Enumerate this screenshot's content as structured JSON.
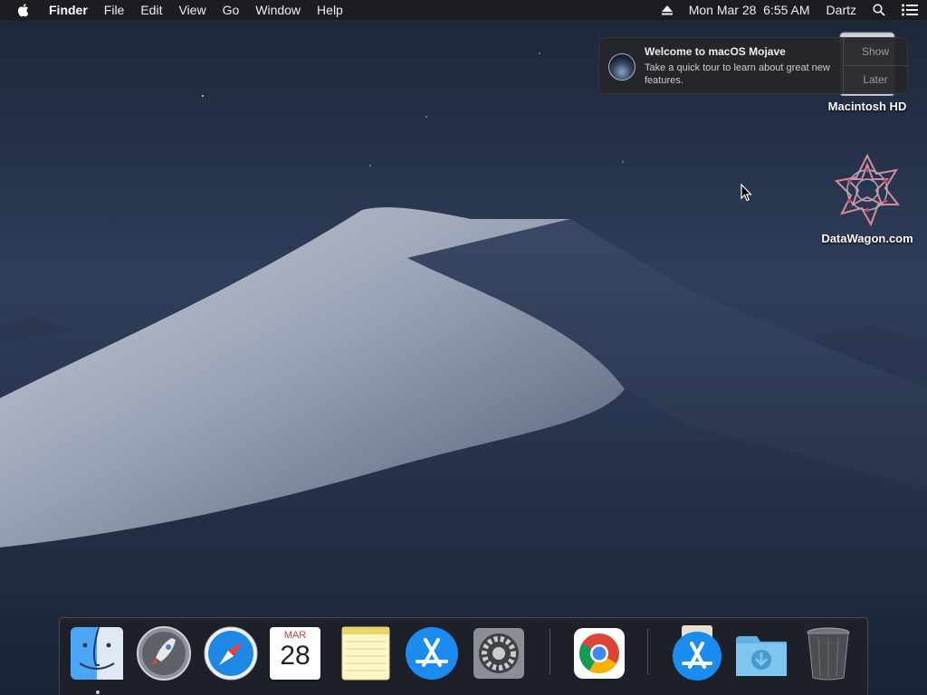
{
  "menubar": {
    "app_name": "Finder",
    "items": [
      "File",
      "Edit",
      "View",
      "Go",
      "Window",
      "Help"
    ],
    "clock": "Mon Mar 28  6:55 AM",
    "user": "Dartz",
    "icons": [
      "apple-icon",
      "eject-icon",
      "spotlight-search-icon",
      "notification-center-icon"
    ]
  },
  "notification": {
    "title": "Welcome to macOS Mojave",
    "text": "Take a quick tour to learn about great new features.",
    "show_label": "Show",
    "later_label": "Later",
    "icon": "mojave-icon"
  },
  "desktop_icons": [
    {
      "label": "Macintosh HD",
      "icon": "hard-drive-icon"
    },
    {
      "label": "DataWagon.com",
      "icon": "datawagon-icon"
    }
  ],
  "dock": {
    "calendar_month": "MAR",
    "calendar_day": "28",
    "items": [
      {
        "icon": "finder-icon",
        "running": true
      },
      {
        "icon": "launchpad-icon"
      },
      {
        "icon": "safari-icon"
      },
      {
        "icon": "calendar-icon"
      },
      {
        "icon": "notes-icon"
      },
      {
        "icon": "app-store-icon"
      },
      {
        "icon": "system-preferences-icon"
      },
      {
        "icon": "chrome-icon"
      },
      {
        "icon": "app-store-downloads-icon"
      },
      {
        "icon": "downloads-folder-icon"
      },
      {
        "icon": "trash-icon"
      }
    ]
  },
  "colors": {
    "menubar_bg": "#1c1c20",
    "wallpaper_sky": "#25324a",
    "dune_light": "#b7bccb",
    "safari_blue": "#1e88e5",
    "app_store_blue": "#1a8cf0"
  }
}
